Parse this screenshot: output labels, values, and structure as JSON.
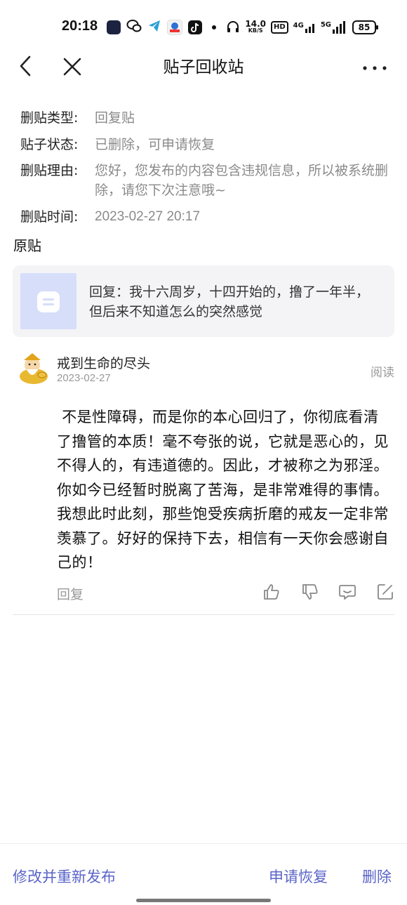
{
  "status_bar": {
    "time": "20:18",
    "net_speed_value": "14.0",
    "net_speed_unit": "KB/S",
    "hd_label": "HD",
    "network_4g": "4G",
    "network_5g": "5G",
    "battery": "85"
  },
  "nav": {
    "title": "贴子回收站"
  },
  "info": {
    "type_label": "删贴类型:",
    "type_value": "回复贴",
    "status_label": "贴子状态:",
    "status_value": "已删除，可申请恢复",
    "reason_label": "删贴理由:",
    "reason_value": "您好，您发布的内容包含违规信息，所以被系统删除，请您下次注意哦~",
    "time_label": "删贴时间:",
    "time_value": "2023-02-27 20:17"
  },
  "original": {
    "section_title": "原贴",
    "preview_text": "回复：我十六周岁，十四开始的，撸了一年半，但后来不知道怎么的突然感觉"
  },
  "reply": {
    "author": "戒到生命的尽头",
    "date": "2023-02-27",
    "read_label": "阅读",
    "body": " 不是性障碍，而是你的本心回归了，你彻底看清了撸管的本质！毫不夸张的说，它就是恶心的，见不得人的，有违道德的。因此，才被称之为邪淫。你如今已经暂时脱离了苦海，是非常难得的事情。我想此时此刻，那些饱受疾病折磨的戒友一定非常羡慕了。好好的保持下去，相信有一天你会感谢自己的！",
    "reply_label": "回复"
  },
  "bottom": {
    "edit_republish": "修改并重新发布",
    "request_restore": "申请恢复",
    "delete": "删除"
  },
  "colors": {
    "accent": "#5a64c8",
    "muted_text": "#8a8a8a",
    "card_bg": "#f4f4f6"
  }
}
